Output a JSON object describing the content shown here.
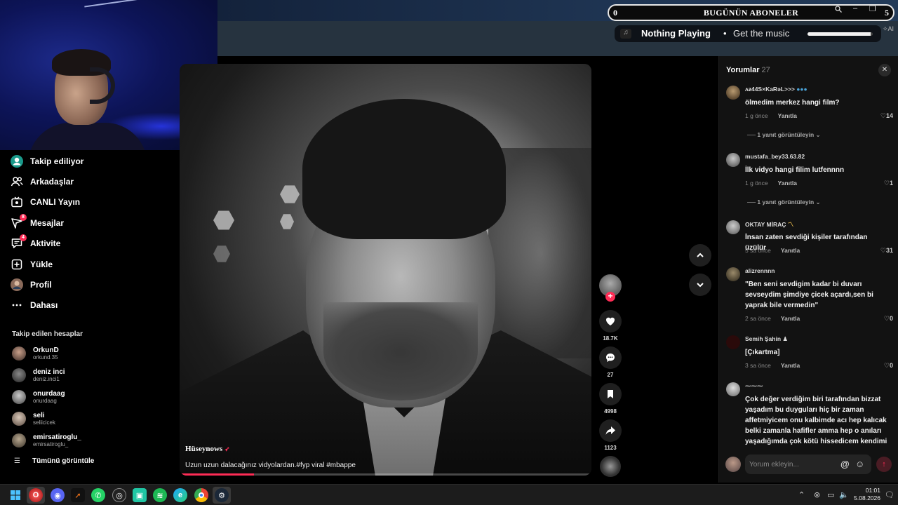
{
  "overlay": {
    "subs_left_count": "0",
    "subs_title": "BUGÜNÜN ABONELER",
    "subs_right_count": "5",
    "now_playing": "Nothing Playing",
    "get_music": "Get the music",
    "music_progress": 0.97,
    "ai_badge": "AI"
  },
  "sidebar": {
    "items": [
      {
        "label": "Takip ediliyor",
        "icon": "following-icon"
      },
      {
        "label": "Arkadaşlar",
        "icon": "friends-icon"
      },
      {
        "label": "CANLI Yayın",
        "icon": "live-icon"
      },
      {
        "label": "Mesajlar",
        "icon": "inbox-icon",
        "badge": "8"
      },
      {
        "label": "Aktivite",
        "icon": "activity-icon",
        "badge": "4"
      },
      {
        "label": "Yükle",
        "icon": "upload-icon"
      },
      {
        "label": "Profil",
        "icon": "profile-icon"
      },
      {
        "label": "Dahası",
        "icon": "more-icon"
      }
    ],
    "following_header": "Takip edilen hesaplar",
    "accounts": [
      {
        "name": "OrkunD",
        "handle": "orkund.35"
      },
      {
        "name": "deniz inci",
        "handle": "deniz.inci1"
      },
      {
        "name": "onurdaag",
        "handle": "onurdaag"
      },
      {
        "name": "seli",
        "handle": "seliicicek"
      },
      {
        "name": "emirsatiroglu_",
        "handle": "emirsatiroglu_"
      }
    ],
    "see_all": "Tümünü görüntüle"
  },
  "video": {
    "author": "Hüseynows",
    "caption": "Uzun uzun dalacağınız vidyolardan.#fyp viral #mbappe",
    "progress": 0.18
  },
  "actions": {
    "likes": "18.7K",
    "comments": "27",
    "saves": "4998",
    "shares": "1123"
  },
  "comments": {
    "title": "Yorumlar",
    "count": "27",
    "reply_label": "Yanıtla",
    "items": [
      {
        "user": "ʌƶ44S×KaRəL>>>",
        "text": "ölmedim merkez hangi film?",
        "time": "1 g önce",
        "likes": "14",
        "view_replies": "1 yanıt görüntüleyin"
      },
      {
        "user": "mustafa_bey33.63.82",
        "text": "İlk vidyo hangi filim lutfennnn",
        "time": "1 g önce",
        "likes": "1",
        "view_replies": "1 yanıt görüntüleyin"
      },
      {
        "user": "OKTAY MİRAÇ",
        "text": "İnsan zaten sevdiği kişiler tarafından üzülür",
        "time": "5 sa önce",
        "likes": "31"
      },
      {
        "user": "alizrennnn",
        "text": "\"Ben seni sevdigim kadar bi duvarı sevseydim şimdiye çicek açardı,sen bi yaprak bile vermedin\"",
        "time": "2 sa önce",
        "likes": "0"
      },
      {
        "user": "Semih Şahin",
        "text": "[Çıkartma]",
        "time": "3 sa önce",
        "likes": "0"
      },
      {
        "user": "",
        "text": "Çok değer verdiğim biri tarafından bizzat yaşadım bu duyguları hiç bir zaman affetmiyicem onu kalbimde acı hep kalıcak belki zamanla hafifler amma hep o anıları yaşadığımda çok kötü hissedicem kendimi"
      }
    ],
    "input_placeholder": "Yorum ekleyin...",
    "at_symbol": "@"
  },
  "taskbar": {
    "time": "01:01",
    "date": "5.08.2026"
  },
  "colors": {
    "accent": "#fe2c55"
  }
}
